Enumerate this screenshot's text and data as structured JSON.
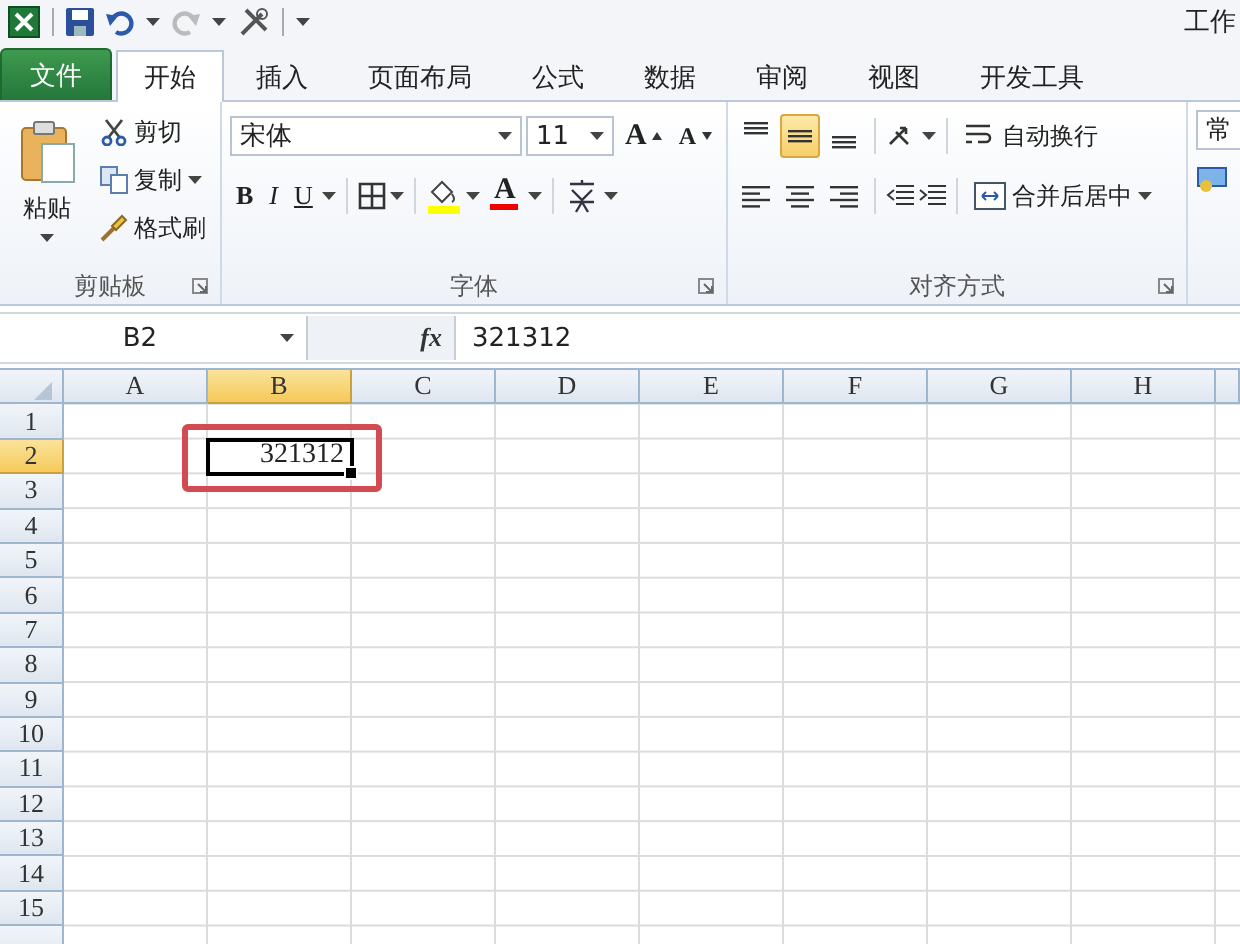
{
  "quick_access": {
    "title": "工作"
  },
  "tabs": [
    {
      "label": "文件",
      "kind": "file",
      "selected": false
    },
    {
      "label": "开始",
      "kind": "tab",
      "selected": true
    },
    {
      "label": "插入",
      "kind": "tab",
      "selected": false
    },
    {
      "label": "页面布局",
      "kind": "tab",
      "selected": false
    },
    {
      "label": "公式",
      "kind": "tab",
      "selected": false
    },
    {
      "label": "数据",
      "kind": "tab",
      "selected": false
    },
    {
      "label": "审阅",
      "kind": "tab",
      "selected": false
    },
    {
      "label": "视图",
      "kind": "tab",
      "selected": false
    },
    {
      "label": "开发工具",
      "kind": "tab",
      "selected": false
    }
  ],
  "clipboard": {
    "paste": "粘贴",
    "cut": "剪切",
    "copy": "复制",
    "format_painter": "格式刷",
    "label": "剪贴板"
  },
  "font": {
    "name": "宋体",
    "size": "11",
    "grow": "A",
    "shrink": "A",
    "bold": "B",
    "italic": "I",
    "underline": "U",
    "font_color": "A",
    "label": "字体"
  },
  "alignment": {
    "vertical": [
      {
        "kind": "top",
        "selected": false
      },
      {
        "kind": "middle",
        "selected": true
      },
      {
        "kind": "bottom",
        "selected": false
      }
    ],
    "horizontal": [
      {
        "kind": "left"
      },
      {
        "kind": "center"
      },
      {
        "kind": "right"
      }
    ],
    "wrap_text": "自动换行",
    "merge_center": "合并后居中",
    "label": "对齐方式"
  },
  "number": {
    "format": "常"
  },
  "formula_bar": {
    "name_box": "B2",
    "function_label": "fx",
    "value": "321312"
  },
  "sheet": {
    "columns": [
      {
        "label": "A",
        "selected": false
      },
      {
        "label": "B",
        "selected": true
      },
      {
        "label": "C",
        "selected": false
      },
      {
        "label": "D",
        "selected": false
      },
      {
        "label": "E",
        "selected": false
      },
      {
        "label": "F",
        "selected": false
      },
      {
        "label": "G",
        "selected": false
      },
      {
        "label": "H",
        "selected": false
      }
    ],
    "rows": [
      {
        "label": "1",
        "selected": false,
        "cells": []
      },
      {
        "label": "2",
        "selected": true,
        "cells": [
          null,
          {
            "value": "321312",
            "selected": true,
            "highlighted": true
          }
        ]
      },
      {
        "label": "3",
        "selected": false,
        "cells": []
      },
      {
        "label": "4",
        "selected": false,
        "cells": []
      },
      {
        "label": "5",
        "selected": false,
        "cells": []
      },
      {
        "label": "6",
        "selected": false,
        "cells": []
      },
      {
        "label": "7",
        "selected": false,
        "cells": []
      },
      {
        "label": "8",
        "selected": false,
        "cells": []
      },
      {
        "label": "9",
        "selected": false,
        "cells": []
      },
      {
        "label": "10",
        "selected": false,
        "cells": []
      },
      {
        "label": "11",
        "selected": false,
        "cells": []
      },
      {
        "label": "12",
        "selected": false,
        "cells": []
      },
      {
        "label": "13",
        "selected": false,
        "cells": []
      },
      {
        "label": "14",
        "selected": false,
        "cells": []
      },
      {
        "label": "15",
        "selected": false,
        "cells": []
      }
    ]
  }
}
